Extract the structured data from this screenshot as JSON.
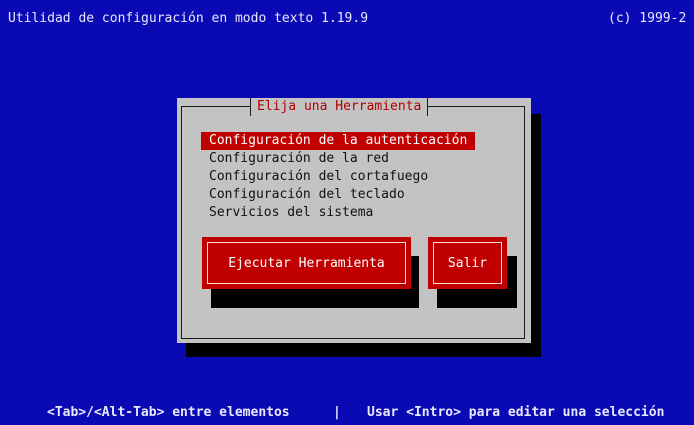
{
  "header": {
    "title": "Utilidad de configuración en modo texto 1.19.9",
    "copyright": "(c) 1999-2"
  },
  "dialog": {
    "title": "Elija una Herramienta",
    "items": [
      {
        "label": "Configuración de la autenticación",
        "selected": true
      },
      {
        "label": "Configuración de la red",
        "selected": false
      },
      {
        "label": "Configuración del cortafuego",
        "selected": false
      },
      {
        "label": "Configuración del teclado",
        "selected": false
      },
      {
        "label": "Servicios del sistema",
        "selected": false
      }
    ],
    "run_button_label": "Ejecutar Herramienta",
    "quit_button_label": "Salir"
  },
  "footer": {
    "hint_left": "<Tab>/<Alt-Tab> entre elementos",
    "separator": "|",
    "hint_right": "Usar <Intro> para editar una selección"
  },
  "colors": {
    "background": "#0a0ab4",
    "dialog": "#c3c3c3",
    "accent": "#c00000",
    "title_text": "#b00000"
  }
}
